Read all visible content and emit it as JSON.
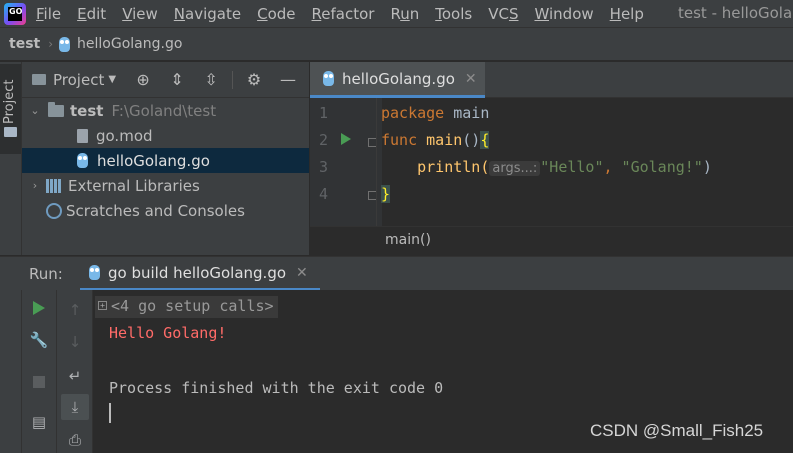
{
  "menubar": {
    "items": [
      {
        "pre": "",
        "u": "F",
        "post": "ile"
      },
      {
        "pre": "",
        "u": "E",
        "post": "dit"
      },
      {
        "pre": "",
        "u": "V",
        "post": "iew"
      },
      {
        "pre": "",
        "u": "N",
        "post": "avigate"
      },
      {
        "pre": "",
        "u": "C",
        "post": "ode"
      },
      {
        "pre": "",
        "u": "R",
        "post": "efactor"
      },
      {
        "pre": "R",
        "u": "u",
        "post": "n"
      },
      {
        "pre": "",
        "u": "T",
        "post": "ools"
      },
      {
        "pre": "VC",
        "u": "S",
        "post": ""
      },
      {
        "pre": "",
        "u": "W",
        "post": "indow"
      },
      {
        "pre": "",
        "u": "H",
        "post": "elp"
      }
    ],
    "window_title": "test - helloGolan"
  },
  "navbar": {
    "project": "test",
    "file": "helloGolang.go"
  },
  "left_strip": {
    "project_tab": "Project"
  },
  "project_panel": {
    "selector": "Project",
    "tree": {
      "root_name": "test",
      "root_path": "F:\\Goland\\test",
      "files": [
        "go.mod",
        "helloGolang.go"
      ],
      "external_libraries": "External Libraries",
      "scratches": "Scratches and Consoles"
    }
  },
  "editor": {
    "tab_label": "helloGolang.go",
    "line_numbers": [
      "1",
      "2",
      "3",
      "4"
    ],
    "code": {
      "l1_kw": "package",
      "l1_rest": " main",
      "l2_kw": "func",
      "l2_fn": " main",
      "l2_parens": "()",
      "l2_brace": "{",
      "l3_indent": "    ",
      "l3_call": "println(",
      "l3_hint": "args...:",
      "l3_s1": "\"Hello\"",
      "l3_comma": ", ",
      "l3_s2": "\"Golang!\"",
      "l3_close": ")",
      "l4_brace": "}"
    },
    "breadcrumb": "main()"
  },
  "run_panel": {
    "label": "Run:",
    "tab_label": "go build helloGolang.go",
    "console": {
      "setup_calls": "<4 go setup calls>",
      "output": "Hello Golang!",
      "exit_message": "Process finished with the exit code 0"
    }
  },
  "watermark": "CSDN @Small_Fish25",
  "colors": {
    "accent": "#4a88c7",
    "keyword": "#cc7832",
    "function": "#ffc66d",
    "string": "#6a8759",
    "error_output": "#ff6b68",
    "run_green": "#499c54"
  }
}
